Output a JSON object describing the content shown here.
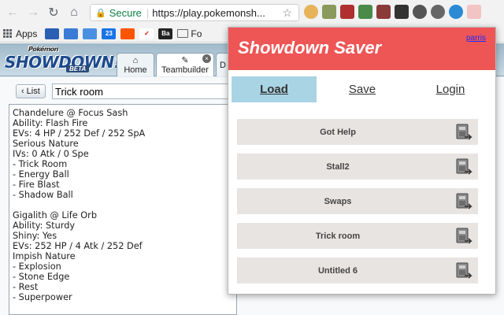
{
  "browser": {
    "secure_label": "Secure",
    "url": "https://play.pokemonsh...",
    "bookmarks": {
      "apps_label": "Apps",
      "items": [
        "",
        "",
        "23",
        "",
        "",
        "Ba",
        "Fo"
      ]
    }
  },
  "showdown": {
    "logo_top": "Pokémon",
    "logo_main": "SHOWDOWN!",
    "logo_beta": "BETA",
    "tabs": {
      "home": "Home",
      "teambuilder": "Teambuilder",
      "partial": "D"
    },
    "list_button": "List",
    "team_name": "Trick room",
    "import_lines": [
      "Chandelure @ Focus Sash",
      "Ability: Flash Fire",
      "EVs: 4 HP / 252 Def / 252 SpA",
      "Serious Nature",
      "IVs: 0 Atk / 0 Spe",
      "- Trick Room",
      "- Energy Ball",
      "- Fire Blast",
      "- Shadow Ball",
      "",
      "Gigalith @ Life Orb",
      "Ability: Sturdy",
      "Shiny: Yes",
      "EVs: 252 HP / 4 Atk / 252 Def",
      "Impish Nature",
      "- Explosion",
      "- Stone Edge",
      "- Rest",
      "- Superpower"
    ]
  },
  "popup": {
    "title": "Showdown Saver",
    "username": "parris",
    "nav": {
      "load": "Load",
      "save": "Save",
      "login": "Login"
    },
    "teams": [
      {
        "name": "Got Help"
      },
      {
        "name": "Stall2"
      },
      {
        "name": "Swaps"
      },
      {
        "name": "Trick room"
      },
      {
        "name": "Untitled 6"
      }
    ]
  },
  "colors": {
    "popup_header": "#ee5555",
    "active_nav": "#a9d4e4",
    "secure_green": "#0b8043"
  }
}
